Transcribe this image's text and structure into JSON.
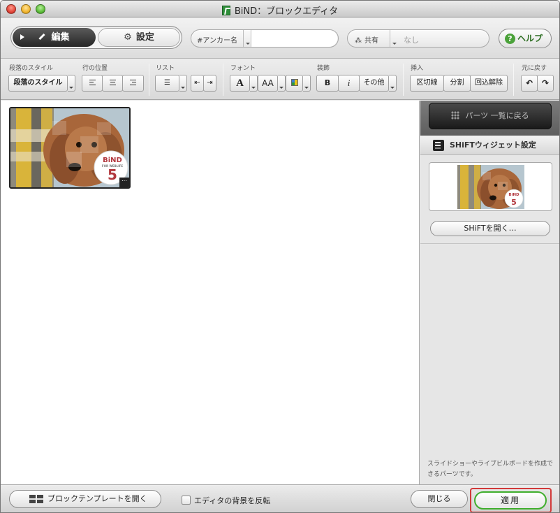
{
  "window": {
    "title": "BiND：ブロックエディタ"
  },
  "mode": {
    "edit_label": "編集",
    "setting_label": "設定"
  },
  "anchor": {
    "label": "#アンカー名",
    "value": ""
  },
  "share": {
    "label": "共有",
    "value": "なし"
  },
  "help": {
    "label": "ヘルプ"
  },
  "toolbar": {
    "groups": {
      "paragraph_style": "段落のスタイル",
      "line_position": "行の位置",
      "list": "リスト",
      "font": "フォント",
      "decoration": "装飾",
      "insert": "挿入",
      "undo": "元に戻す"
    },
    "paragraph_style_button": "段落のスタイル",
    "font_a": "A",
    "font_aa": "AA",
    "bold": "B",
    "italic": "i",
    "other": "その他",
    "divider": "区切線",
    "split": "分割",
    "wrap_remove": "回込解除",
    "undo_icon": "↶",
    "redo_icon": "↷"
  },
  "thumb": {
    "logo": "BiND",
    "logo_sub": "FOR WEBLIFE",
    "logo_num": "5"
  },
  "panel": {
    "back_label": "パーツ 一覧に戻る",
    "shift_title": "SHiFTウィジェット設定",
    "open_label": "SHiFTを開く…",
    "note": "スライドショーやライブビルボードを作成できるパーツです。"
  },
  "bottom": {
    "template_label": "ブロックテンプレートを開く",
    "invert_label": "エディタの背景を反転",
    "close_label": "閉じる",
    "apply_label": "適用"
  },
  "colors": {
    "accent_green": "#3fae2c",
    "apply_highlight": "#d23a3a"
  }
}
